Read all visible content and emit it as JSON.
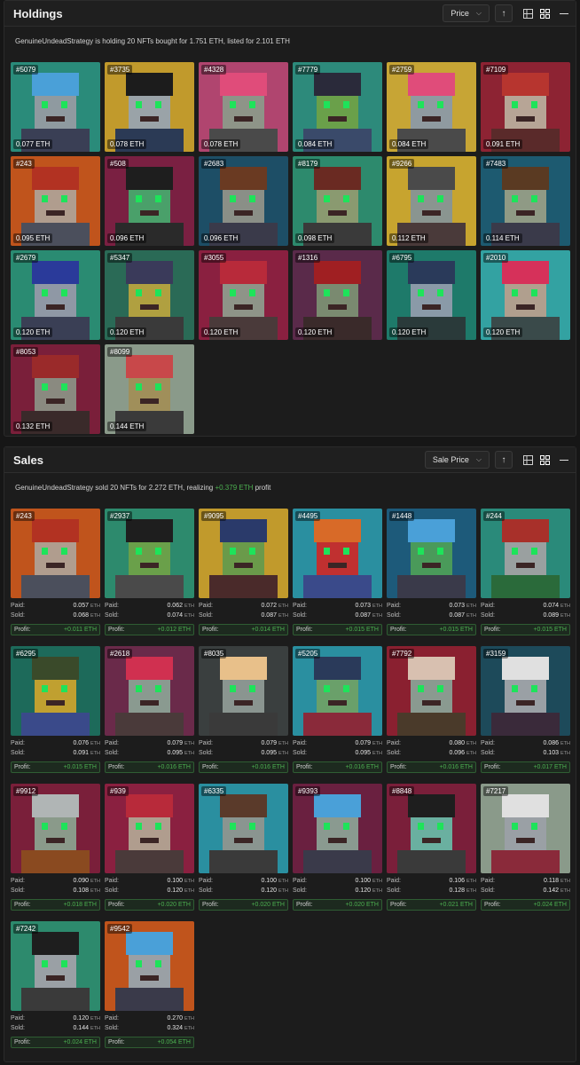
{
  "holdings": {
    "title": "Holdings",
    "sort_label": "Price",
    "summary": "GenuineUndeadStrategy is holding 20 NFTs bought for 1.751 ETH, listed for 2.101 ETH",
    "items": [
      {
        "id": "#5079",
        "price": "0.077 ETH",
        "bg": "#2a8b7a",
        "hair": "#4aa0d8",
        "skin": "#8f9aa0",
        "body": "#3a3f55"
      },
      {
        "id": "#3735",
        "price": "0.078 ETH",
        "bg": "#c19a2c",
        "hair": "#1c1c1c",
        "skin": "#9aa3a8",
        "body": "#2b3a55"
      },
      {
        "id": "#4328",
        "price": "0.078 ETH",
        "bg": "#b0456f",
        "hair": "#e04c7a",
        "skin": "#8e9488",
        "body": "#4a4a4a"
      },
      {
        "id": "#7779",
        "price": "0.084 ETH",
        "bg": "#2d8a7b",
        "hair": "#2a2a3a",
        "skin": "#6aa04a",
        "body": "#3a4a6a"
      },
      {
        "id": "#2759",
        "price": "0.084 ETH",
        "bg": "#c7a535",
        "hair": "#e04c7a",
        "skin": "#8f9aa0",
        "body": "#4a4a4a"
      },
      {
        "id": "#7109",
        "price": "0.091 ETH",
        "bg": "#8d2333",
        "hair": "#b7352f",
        "skin": "#b7a596",
        "body": "#5a2a2a"
      },
      {
        "id": "#243",
        "price": "0.095 ETH",
        "bg": "#c0541c",
        "hair": "#b23222",
        "skin": "#b09d8e",
        "body": "#4b4f5c"
      },
      {
        "id": "#508",
        "price": "0.096 ETH",
        "bg": "#7a2042",
        "hair": "#1e1e1e",
        "skin": "#4aa06a",
        "body": "#2a2a2a"
      },
      {
        "id": "#2683",
        "price": "0.096 ETH",
        "bg": "#1d4e66",
        "hair": "#6a3a22",
        "skin": "#8a8f87",
        "body": "#3a3a4a"
      },
      {
        "id": "#8179",
        "price": "0.098 ETH",
        "bg": "#2d8a6d",
        "hair": "#6a2a22",
        "skin": "#8a9a70",
        "body": "#3a3a3a"
      },
      {
        "id": "#9266",
        "price": "0.112 ETH",
        "bg": "#c7a42f",
        "hair": "#4a4a4a",
        "skin": "#8a9590",
        "body": "#4a3a3a"
      },
      {
        "id": "#7483",
        "price": "0.114 ETH",
        "bg": "#1d5a70",
        "hair": "#5a3a22",
        "skin": "#8f9a85",
        "body": "#3a3a4a"
      },
      {
        "id": "#2679",
        "price": "0.120 ETH",
        "bg": "#2a8b72",
        "hair": "#2a3a9a",
        "skin": "#8f98a5",
        "body": "#3a3f55"
      },
      {
        "id": "#5347",
        "price": "0.120 ETH",
        "bg": "#2a6a56",
        "hair": "#3a3a5a",
        "skin": "#b0a040",
        "body": "#3a3a3a"
      },
      {
        "id": "#3055",
        "price": "0.120 ETH",
        "bg": "#8a2040",
        "hair": "#b82a3a",
        "skin": "#8e9488",
        "body": "#4a3a3a"
      },
      {
        "id": "#1316",
        "price": "0.120 ETH",
        "bg": "#5a2a4a",
        "hair": "#a01f22",
        "skin": "#7a8a70",
        "body": "#3a2a2a"
      },
      {
        "id": "#6795",
        "price": "0.120 ETH",
        "bg": "#1e7a6a",
        "hair": "#2a3a5a",
        "skin": "#8a9aa8",
        "body": "#2a3a3a"
      },
      {
        "id": "#2010",
        "price": "0.120 ETH",
        "bg": "#33a2a2",
        "hair": "#d6315a",
        "skin": "#b09f8e",
        "body": "#3a4a4a"
      },
      {
        "id": "#8053",
        "price": "0.132 ETH",
        "bg": "#7a1f3a",
        "hair": "#9a2a2a",
        "skin": "#8a8a80",
        "body": "#3a2a2a"
      },
      {
        "id": "#8099",
        "price": "0.144 ETH",
        "bg": "#8a9a8a",
        "hair": "#c8484a",
        "skin": "#a08f5a",
        "body": "#3a3a3a"
      }
    ]
  },
  "sales": {
    "title": "Sales",
    "sort_label": "Sale Price",
    "summary_prefix": "GenuineUndeadStrategy sold 20 NFTs for 2.272 ETH, realizing ",
    "summary_profit": "+0.379 ETH",
    "summary_suffix": " profit",
    "labels": {
      "paid": "Paid:",
      "sold": "Sold:",
      "profit": "Profit:",
      "unit": "ETH"
    },
    "items": [
      {
        "id": "#243",
        "paid": "0.057",
        "sold": "0.068",
        "profit": "+0.011 ETH",
        "bg": "#c0541c",
        "hair": "#b23222",
        "skin": "#b09d8e",
        "body": "#4b4f5c"
      },
      {
        "id": "#2937",
        "paid": "0.062",
        "sold": "0.074",
        "profit": "+0.012 ETH",
        "bg": "#2d8a6d",
        "hair": "#1e1e1e",
        "skin": "#6aa04a",
        "body": "#4a4a4a"
      },
      {
        "id": "#9095",
        "paid": "0.072",
        "sold": "0.087",
        "profit": "+0.014 ETH",
        "bg": "#c19a2c",
        "hair": "#2a3a6a",
        "skin": "#6a9a4a",
        "body": "#4a2a2a"
      },
      {
        "id": "#4495",
        "paid": "0.073",
        "sold": "0.087",
        "profit": "+0.015 ETH",
        "bg": "#2a8fa0",
        "hair": "#d86a28",
        "skin": "#c03030",
        "body": "#3a4a8a"
      },
      {
        "id": "#1448",
        "paid": "0.073",
        "sold": "0.087",
        "profit": "+0.015 ETH",
        "bg": "#1d5a7a",
        "hair": "#4aa0d8",
        "skin": "#4a9a5a",
        "body": "#3a3a4a"
      },
      {
        "id": "#244",
        "paid": "0.074",
        "sold": "0.089",
        "profit": "+0.015 ETH",
        "bg": "#2a8a7a",
        "hair": "#a8302a",
        "skin": "#9aa0a0",
        "body": "#2a6a3a"
      },
      {
        "id": "#6295",
        "paid": "0.076",
        "sold": "0.091",
        "profit": "+0.015 ETH",
        "bg": "#1d6a5a",
        "hair": "#3a4a2a",
        "skin": "#c0a030",
        "body": "#3a4a8a"
      },
      {
        "id": "#2618",
        "paid": "0.079",
        "sold": "0.095",
        "profit": "+0.016 ETH",
        "bg": "#6a2a4a",
        "hair": "#d03050",
        "skin": "#8a9a90",
        "body": "#4a3a3a"
      },
      {
        "id": "#8035",
        "paid": "0.079",
        "sold": "0.095",
        "profit": "+0.016 ETH",
        "bg": "#3a3f3f",
        "hair": "#e8c08a",
        "skin": "#8a9590",
        "body": "#3a3a3a"
      },
      {
        "id": "#5205",
        "paid": "0.079",
        "sold": "0.095",
        "profit": "+0.016 ETH",
        "bg": "#2a8fa0",
        "hair": "#2a3a5a",
        "skin": "#6aa06a",
        "body": "#8a2a3a"
      },
      {
        "id": "#7792",
        "paid": "0.080",
        "sold": "0.096",
        "profit": "+0.016 ETH",
        "bg": "#8a2030",
        "hair": "#d8c0b0",
        "skin": "#8a9a90",
        "body": "#4a3a2a"
      },
      {
        "id": "#3159",
        "paid": "0.086",
        "sold": "0.103",
        "profit": "+0.017 ETH",
        "bg": "#1d4a5a",
        "hair": "#e0e0e0",
        "skin": "#9aa0a5",
        "body": "#3a2a3a"
      },
      {
        "id": "#9912",
        "paid": "0.090",
        "sold": "0.108",
        "profit": "+0.018 ETH",
        "bg": "#7a1f3a",
        "hair": "#b0b5b5",
        "skin": "#8a9a8a",
        "body": "#8a4a20"
      },
      {
        "id": "#939",
        "paid": "0.100",
        "sold": "0.120",
        "profit": "+0.020 ETH",
        "bg": "#8a2040",
        "hair": "#b82a3a",
        "skin": "#b09d8e",
        "body": "#4a3a3a"
      },
      {
        "id": "#6335",
        "paid": "0.100",
        "sold": "0.120",
        "profit": "+0.020 ETH",
        "bg": "#2a8fa0",
        "hair": "#5a3a2a",
        "skin": "#8a9590",
        "body": "#3a3a3a"
      },
      {
        "id": "#9393",
        "paid": "0.100",
        "sold": "0.120",
        "profit": "+0.020 ETH",
        "bg": "#6a2040",
        "hair": "#4aa0d8",
        "skin": "#8a9a90",
        "body": "#3a3a4a"
      },
      {
        "id": "#8848",
        "paid": "0.106",
        "sold": "0.128",
        "profit": "+0.021 ETH",
        "bg": "#7a1f3a",
        "hair": "#1e1e1e",
        "skin": "#6ab0a0",
        "body": "#3a3a3a"
      },
      {
        "id": "#7217",
        "paid": "0.118",
        "sold": "0.142",
        "profit": "+0.024 ETH",
        "bg": "#8a9a8a",
        "hair": "#e0e0e0",
        "skin": "#9aa0a5",
        "body": "#8a2a3a"
      },
      {
        "id": "#7242",
        "paid": "0.120",
        "sold": "0.144",
        "profit": "+0.024 ETH",
        "bg": "#2d8a6d",
        "hair": "#1e1e1e",
        "skin": "#9aa0a5",
        "body": "#3a3a3a"
      },
      {
        "id": "#9542",
        "paid": "0.270",
        "sold": "0.324",
        "profit": "+0.054 ETH",
        "bg": "#c0541c",
        "hair": "#4aa0d8",
        "skin": "#9aa0a5",
        "body": "#3a3a4a"
      }
    ]
  }
}
